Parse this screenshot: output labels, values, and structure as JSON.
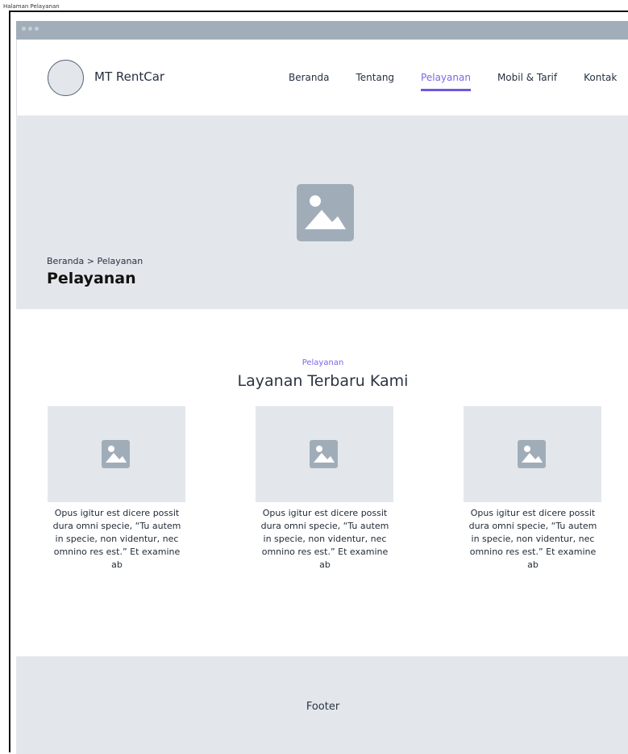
{
  "frame": {
    "label": "Halaman Pelayanan"
  },
  "brand": {
    "name": "MT RentCar"
  },
  "nav": {
    "items": [
      {
        "label": "Beranda"
      },
      {
        "label": "Tentang"
      },
      {
        "label": "Pelayanan"
      },
      {
        "label": "Mobil & Tarif"
      },
      {
        "label": "Kontak"
      }
    ],
    "active": "Pelayanan"
  },
  "hero": {
    "breadcrumb": "Beranda > Pelayanan",
    "title": "Pelayanan",
    "image_icon": "image-placeholder-icon"
  },
  "services": {
    "kicker": "Pelayanan",
    "title": "Layanan Terbaru Kami",
    "cards": [
      {
        "text": "Opus igitur est dicere possit dura omni specie, “Tu autem in specie, non videntur, nec omnino res est.” Et examine ab",
        "icon": "image-placeholder-icon"
      },
      {
        "text": "Opus igitur est dicere possit dura omni specie, “Tu autem in specie, non videntur, nec omnino res est.” Et examine ab",
        "icon": "image-placeholder-icon"
      },
      {
        "text": "Opus igitur est dicere possit dura omni specie, “Tu autem in specie, non videntur, nec omnino res est.” Et examine ab",
        "icon": "image-placeholder-icon"
      }
    ]
  },
  "footer": {
    "label": "Footer"
  },
  "colors": {
    "accent": "#7b67ea",
    "placeholder_bg": "#e3e7ec",
    "chrome_bar": "#a1aeba",
    "text_dark": "#253040"
  }
}
